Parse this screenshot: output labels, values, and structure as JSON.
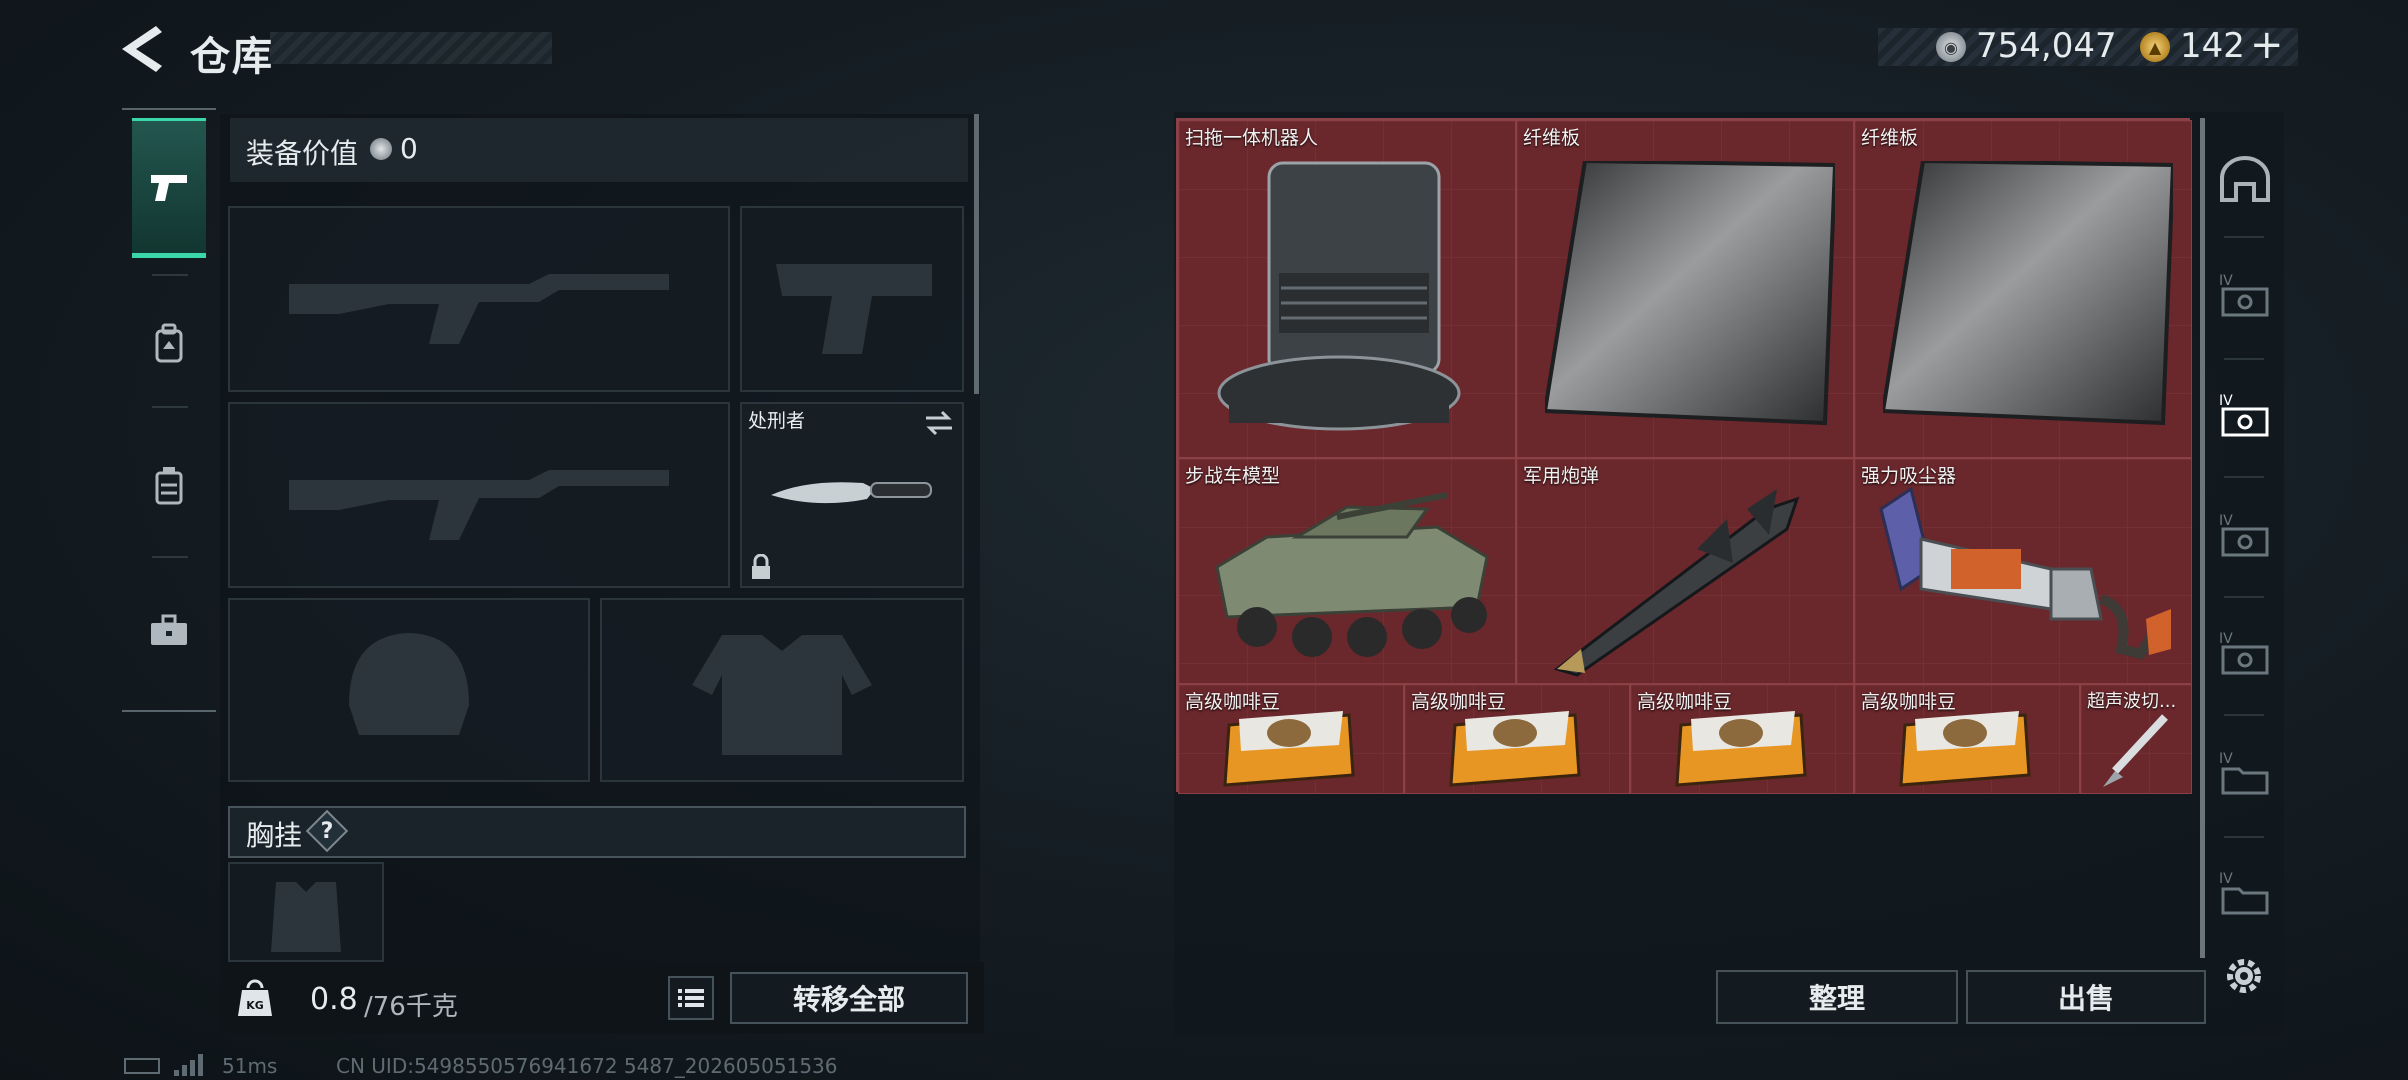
{
  "header": {
    "title": "仓库",
    "silver_amount": "754,047",
    "gold_amount": "142",
    "gold_plus": "+"
  },
  "left_nav": {
    "items": [
      {
        "icon": "pistol-icon",
        "active": true
      },
      {
        "icon": "backpack-icon",
        "active": false
      },
      {
        "icon": "vest-icon",
        "active": false
      },
      {
        "icon": "toolbox-icon",
        "active": false
      }
    ]
  },
  "equipment": {
    "value_label": "装备价值",
    "value_amount": "0",
    "melee_label": "处刑者",
    "chest_rig_label": "胸挂",
    "help": "?",
    "weight_value": "0.8",
    "weight_max": "/76千克",
    "weight_icon_text": "KG",
    "transfer_all_label": "转移全部"
  },
  "storage": {
    "items": [
      {
        "label": "扫拖一体机器人"
      },
      {
        "label": "纤维板"
      },
      {
        "label": "纤维板"
      },
      {
        "label": "步战车模型"
      },
      {
        "label": "军用炮弹"
      },
      {
        "label": "强力吸尘器"
      },
      {
        "label": "高级咖啡豆"
      },
      {
        "label": "高级咖啡豆"
      },
      {
        "label": "高级咖啡豆"
      },
      {
        "label": "高级咖啡豆"
      },
      {
        "label": "超声波切..."
      }
    ],
    "organize_label": "整理",
    "sell_label": "出售"
  },
  "right_rail": {
    "tier_label": "IV"
  },
  "status": {
    "ping": "51ms",
    "uid": "CN UID:5498550576941672 5487_202605051536"
  },
  "colors": {
    "accent": "#39d7a9",
    "grid_red": "#6f2a2f",
    "panel": "#131b20"
  }
}
